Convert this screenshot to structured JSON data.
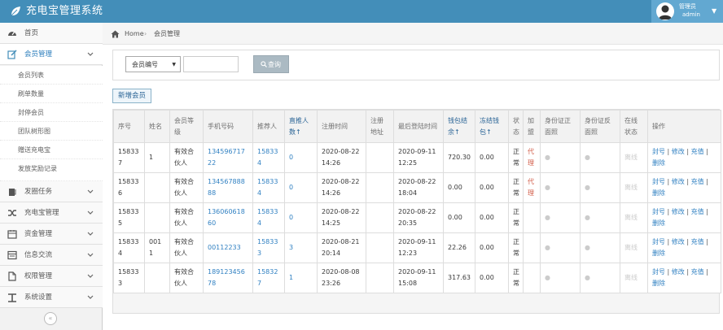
{
  "app": {
    "title": "充电宝管理系统"
  },
  "user": {
    "role": "管理员",
    "name": "admin"
  },
  "sidebar": {
    "items": [
      {
        "label": "首页",
        "icon": "dashboard-icon"
      },
      {
        "label": "会员管理",
        "icon": "edit-icon"
      },
      {
        "label": "发圈任务",
        "icon": "book-icon"
      },
      {
        "label": "充电宝管理",
        "icon": "shuffle-icon"
      },
      {
        "label": "资金管理",
        "icon": "calendar-icon"
      },
      {
        "label": "信息交流",
        "icon": "list-icon"
      },
      {
        "label": "权限管理",
        "icon": "file-icon"
      },
      {
        "label": "系统设置",
        "icon": "text-icon"
      }
    ],
    "submenu": [
      "会员列表",
      "刷单数量",
      "封停会员",
      "团队树形图",
      "赠送充电宝",
      "发放奖励记录"
    ],
    "collapse_glyph": "«"
  },
  "breadcrumb": {
    "home": "Home",
    "separator": "›",
    "current": "会员管理"
  },
  "filter": {
    "select_value": "会员编号",
    "search_value": "",
    "search_button": "查询"
  },
  "add_button": "新增会员",
  "table": {
    "headers": [
      "序号",
      "姓名",
      "会员等级",
      "手机号码",
      "推荐人",
      "直推人数↑",
      "注册时间",
      "注册地址",
      "最后登陆时间",
      "钱包结余↑",
      "冻结钱包↑",
      "状态",
      "加盟",
      "身份证正面照",
      "身份证反面照",
      "在线状态",
      "操作"
    ],
    "actions": {
      "ban": "封号",
      "edit": "修改",
      "recharge": "充值",
      "delete": "删除",
      "divider": "|"
    },
    "rows": [
      {
        "id": "158337",
        "name": "1",
        "level": "有效合伙人",
        "phone": "13459671722",
        "referrer": "158334",
        "direct": "0",
        "reg_time": "2020-08-22 14:26",
        "reg_addr": "",
        "last_login": "2020-09-11 12:25",
        "wallet": "720.30",
        "frozen": "0.00",
        "status": "正常",
        "join": "代理",
        "id_front": "●",
        "id_back": "●",
        "online": "离线"
      },
      {
        "id": "158336",
        "name": "",
        "level": "有效合伙人",
        "phone": "13456788888",
        "referrer": "158334",
        "direct": "0",
        "reg_time": "2020-08-22 14:26",
        "reg_addr": "",
        "last_login": "2020-08-22 18:04",
        "wallet": "0.00",
        "frozen": "0.00",
        "status": "正常",
        "join": "代理",
        "id_front": "●",
        "id_back": "●",
        "online": "离线"
      },
      {
        "id": "158335",
        "name": "",
        "level": "有效合伙人",
        "phone": "13606061860",
        "referrer": "158334",
        "direct": "0",
        "reg_time": "2020-08-22 14:25",
        "reg_addr": "",
        "last_login": "2020-08-22 20:35",
        "wallet": "0.00",
        "frozen": "0.00",
        "status": "正常",
        "join": "",
        "id_front": "●",
        "id_back": "●",
        "online": "离线"
      },
      {
        "id": "158334",
        "name": "0011",
        "level": "有效合伙人",
        "phone": "00112233",
        "referrer": "158333",
        "direct": "3",
        "reg_time": "2020-08-21 20:14",
        "reg_addr": "",
        "last_login": "2020-09-11 12:23",
        "wallet": "22.26",
        "frozen": "0.00",
        "status": "正常",
        "join": "",
        "id_front": "●",
        "id_back": "●",
        "online": "离线"
      },
      {
        "id": "158333",
        "name": "",
        "level": "有效合伙人",
        "phone": "18912345678",
        "referrer": "158327",
        "direct": "1",
        "reg_time": "2020-08-08 23:26",
        "reg_addr": "",
        "last_login": "2020-09-11 15:08",
        "wallet": "317.63",
        "frozen": "0.00",
        "status": "正常",
        "join": "",
        "id_front": "●",
        "id_back": "●",
        "online": "离线"
      }
    ]
  },
  "colors": {
    "topbar": "#438eb9",
    "link": "#3181c2",
    "agent": "#d15b47",
    "button_gray": "#abbac3"
  }
}
